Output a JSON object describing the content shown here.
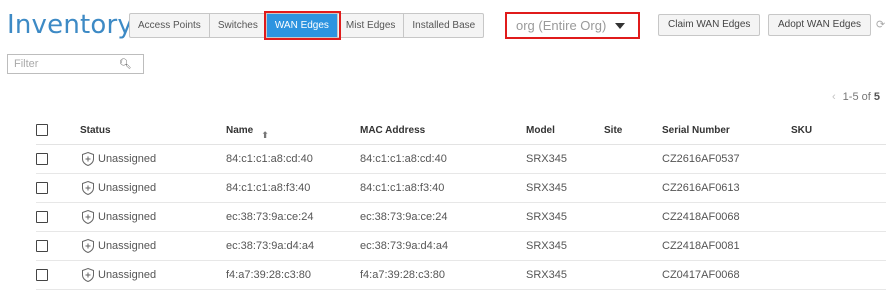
{
  "page": {
    "title": "Inventory"
  },
  "tabs": [
    {
      "label": "Access Points"
    },
    {
      "label": "Switches"
    },
    {
      "label": "WAN Edges"
    },
    {
      "label": "Mist Edges"
    },
    {
      "label": "Installed Base"
    }
  ],
  "active_tab": "WAN Edges",
  "org_select": {
    "value": "org (Entire Org)"
  },
  "actions": {
    "claim_label": "Claim WAN Edges",
    "adopt_label": "Adopt WAN Edges"
  },
  "filter": {
    "placeholder": "Filter",
    "value": ""
  },
  "pager": {
    "range": "1-5 of",
    "total": "5"
  },
  "table": {
    "columns": [
      "Status",
      "Name",
      "MAC Address",
      "Model",
      "Site",
      "Serial Number",
      "SKU"
    ],
    "rows": [
      {
        "status": "Unassigned",
        "name": "84:c1:c1:a8:cd:40",
        "mac": "84:c1:c1:a8:cd:40",
        "model": "SRX345",
        "site": "",
        "serial": "CZ2616AF0537",
        "sku": ""
      },
      {
        "status": "Unassigned",
        "name": "84:c1:c1:a8:f3:40",
        "mac": "84:c1:c1:a8:f3:40",
        "model": "SRX345",
        "site": "",
        "serial": "CZ2616AF0613",
        "sku": ""
      },
      {
        "status": "Unassigned",
        "name": "ec:38:73:9a:ce:24",
        "mac": "ec:38:73:9a:ce:24",
        "model": "SRX345",
        "site": "",
        "serial": "CZ2418AF0068",
        "sku": ""
      },
      {
        "status": "Unassigned",
        "name": "ec:38:73:9a:d4:a4",
        "mac": "ec:38:73:9a:d4:a4",
        "model": "SRX345",
        "site": "",
        "serial": "CZ2418AF0081",
        "sku": ""
      },
      {
        "status": "Unassigned",
        "name": "f4:a7:39:28:c3:80",
        "mac": "f4:a7:39:28:c3:80",
        "model": "SRX345",
        "site": "",
        "serial": "CZ0417AF0068",
        "sku": ""
      }
    ]
  },
  "colors": {
    "accent": "#2d94e0",
    "title": "#3d8ac5",
    "highlight": "#e01b1b"
  }
}
